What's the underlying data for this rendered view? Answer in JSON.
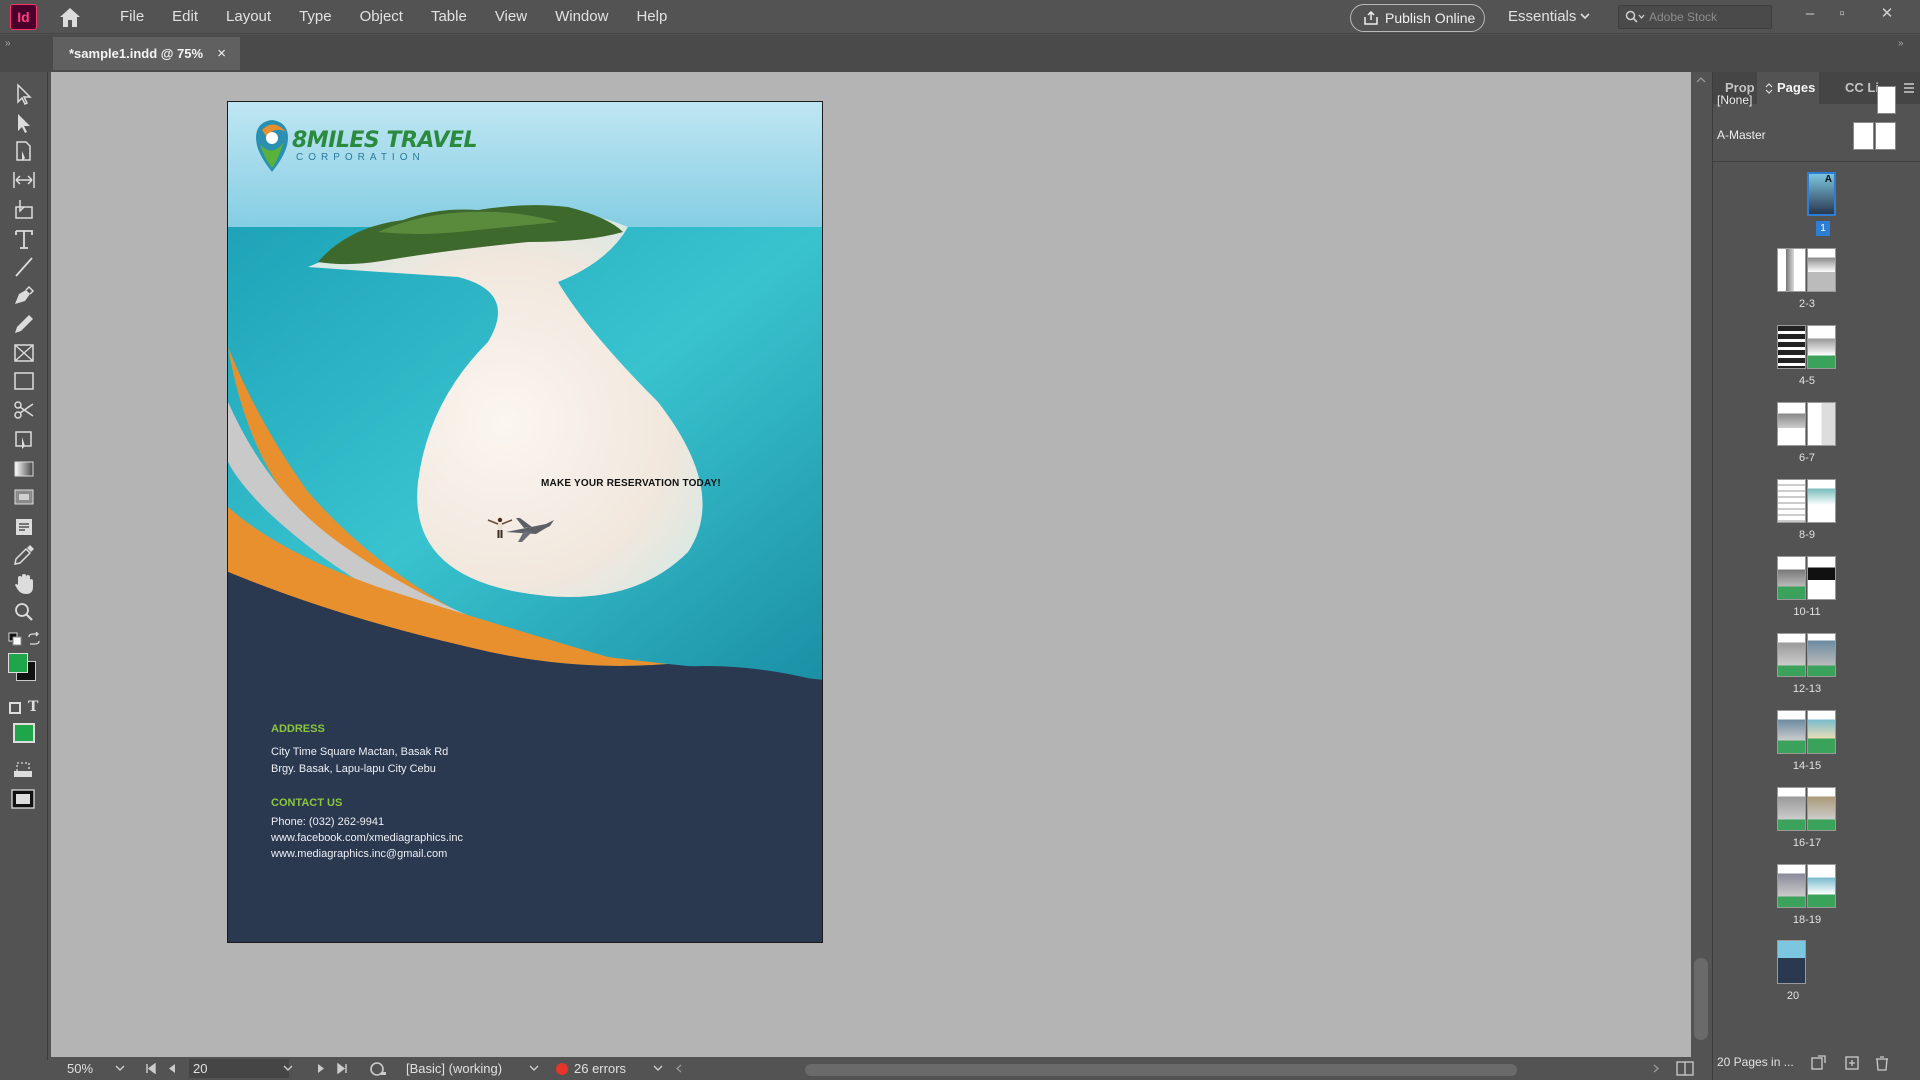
{
  "app": {
    "logo_text": "Id",
    "menus": [
      "File",
      "Edit",
      "Layout",
      "Type",
      "Object",
      "Table",
      "View",
      "Window",
      "Help"
    ],
    "publish_label": "Publish Online",
    "workspace_label": "Essentials",
    "search_placeholder": "Adobe Stock",
    "window_controls": [
      "–",
      "▫",
      "✕"
    ]
  },
  "document_tab": {
    "title": "*sample1.indd @ 75%",
    "close": "×"
  },
  "tools": [
    "selection-tool",
    "direct-selection-tool",
    "page-tool",
    "gap-tool",
    "content-collector-tool",
    "type-tool",
    "line-tool",
    "pen-tool",
    "pencil-tool",
    "rectangle-frame-tool",
    "rectangle-tool",
    "scissors-tool",
    "free-transform-tool",
    "gradient-swatch-tool",
    "gradient-feather-tool",
    "note-tool",
    "eyedropper-tool",
    "hand-tool",
    "zoom-tool"
  ],
  "colors": {
    "fill": "#1fa64a",
    "stroke": "#111111",
    "accent_orange": "#e8902e",
    "page_navy": "#2a3850",
    "heading_green": "#8cc63f"
  },
  "document": {
    "brand_name": "8MILES TRAVEL",
    "brand_sub": "CORPORATION",
    "headline": "MAKE YOUR RESERVATION TODAY!",
    "address_heading": "ADDRESS",
    "address_line1": "City Time Square Mactan, Basak Rd",
    "address_line2": "Brgy. Basak, Lapu-lapu City Cebu",
    "contact_heading": "CONTACT US",
    "phone": "Phone: (032) 262-9941",
    "facebook": "www.facebook.com/xmediagraphics.inc",
    "email": "www.mediagraphics.inc@gmail.com"
  },
  "status": {
    "zoom": "50%",
    "page_number": "20",
    "preflight_profile": "[Basic] (working)",
    "errors": "26 errors"
  },
  "pages_panel": {
    "tabs": [
      "Prop",
      "Pages",
      "CC Li"
    ],
    "masters": [
      "[None]",
      "A-Master"
    ],
    "spreads": [
      "1",
      "2-3",
      "4-5",
      "6-7",
      "8-9",
      "10-11",
      "12-13",
      "14-15",
      "16-17",
      "18-19",
      "20"
    ],
    "page_marker": "A",
    "footer": "20 Pages in ..."
  }
}
